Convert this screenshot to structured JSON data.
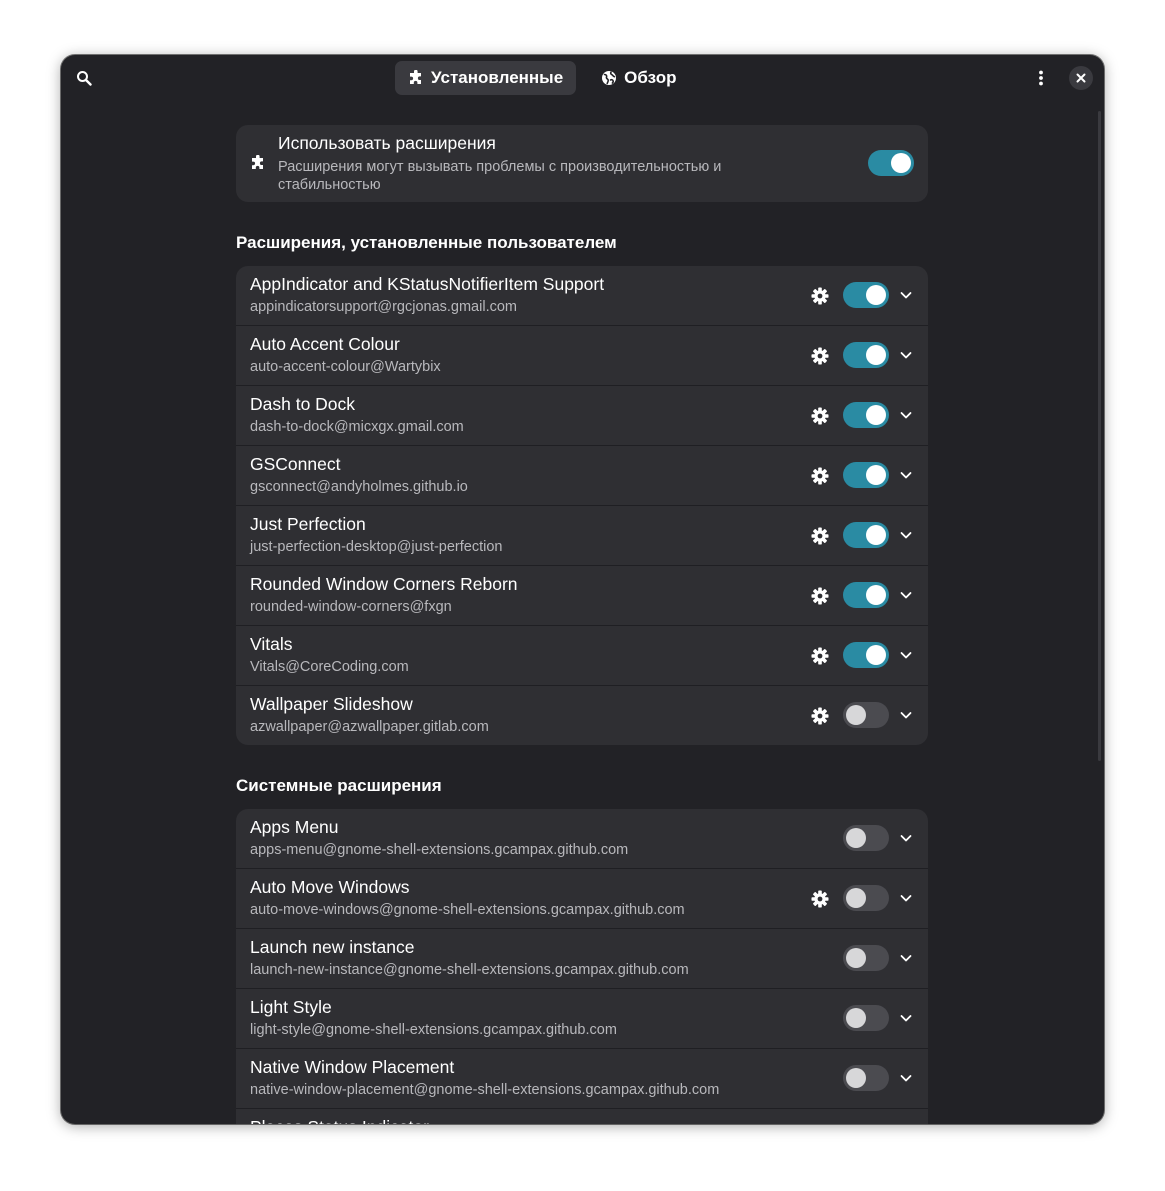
{
  "header": {
    "tabs": [
      {
        "label": "Установленные",
        "icon": "puzzle-icon",
        "active": true
      },
      {
        "label": "Обзор",
        "icon": "globe-icon",
        "active": false
      }
    ]
  },
  "master": {
    "title": "Использовать расширения",
    "subtitle": "Расширения могут вызывать проблемы с производительностью и стабильностью",
    "enabled": true
  },
  "user_section": {
    "title": "Расширения, установленные пользователем",
    "items": [
      {
        "name": "AppIndicator and KStatusNotifierItem Support",
        "uuid": "appindicatorsupport@rgcjonas.gmail.com",
        "settings": true,
        "enabled": true
      },
      {
        "name": "Auto Accent Colour",
        "uuid": "auto-accent-colour@Wartybix",
        "settings": true,
        "enabled": true
      },
      {
        "name": "Dash to Dock",
        "uuid": "dash-to-dock@micxgx.gmail.com",
        "settings": true,
        "enabled": true
      },
      {
        "name": "GSConnect",
        "uuid": "gsconnect@andyholmes.github.io",
        "settings": true,
        "enabled": true
      },
      {
        "name": "Just Perfection",
        "uuid": "just-perfection-desktop@just-perfection",
        "settings": true,
        "enabled": true
      },
      {
        "name": "Rounded Window Corners Reborn",
        "uuid": "rounded-window-corners@fxgn",
        "settings": true,
        "enabled": true
      },
      {
        "name": "Vitals",
        "uuid": "Vitals@CoreCoding.com",
        "settings": true,
        "enabled": true
      },
      {
        "name": "Wallpaper Slideshow",
        "uuid": "azwallpaper@azwallpaper.gitlab.com",
        "settings": true,
        "enabled": false
      }
    ]
  },
  "system_section": {
    "title": "Системные расширения",
    "items": [
      {
        "name": "Apps Menu",
        "uuid": "apps-menu@gnome-shell-extensions.gcampax.github.com",
        "settings": false,
        "enabled": false
      },
      {
        "name": "Auto Move Windows",
        "uuid": "auto-move-windows@gnome-shell-extensions.gcampax.github.com",
        "settings": true,
        "enabled": false
      },
      {
        "name": "Launch new instance",
        "uuid": "launch-new-instance@gnome-shell-extensions.gcampax.github.com",
        "settings": false,
        "enabled": false
      },
      {
        "name": "Light Style",
        "uuid": "light-style@gnome-shell-extensions.gcampax.github.com",
        "settings": false,
        "enabled": false
      },
      {
        "name": "Native Window Placement",
        "uuid": "native-window-placement@gnome-shell-extensions.gcampax.github.com",
        "settings": false,
        "enabled": false
      },
      {
        "name": "Places Status Indicator",
        "uuid": "",
        "settings": false,
        "enabled": false
      }
    ]
  },
  "colors": {
    "accent": "#2a8ba3",
    "window_bg": "#222226",
    "card_bg": "#2f2f33"
  }
}
